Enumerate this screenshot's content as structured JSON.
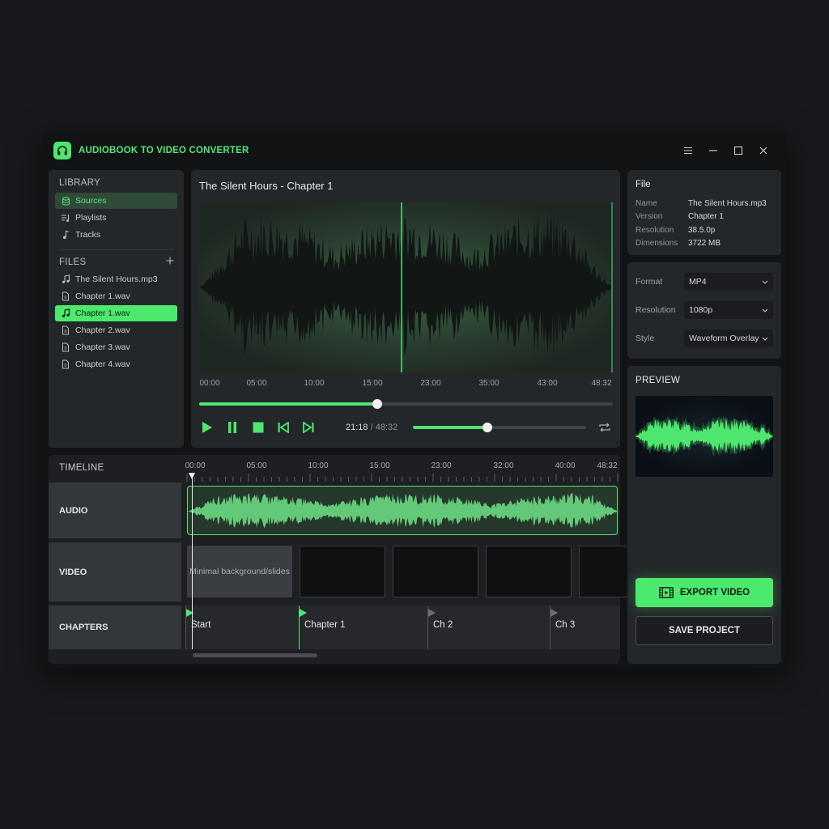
{
  "app": {
    "title": "AUDIOBOOK TO VIDEO CONVERTER"
  },
  "library": {
    "title": "LIBRARY",
    "items": [
      {
        "label": "Sources",
        "icon": "database-icon"
      },
      {
        "label": "Playlists",
        "icon": "playlist-icon"
      },
      {
        "label": "Tracks",
        "icon": "music-note-icon"
      }
    ],
    "files_title": "FILES",
    "files": [
      {
        "label": "The Silent Hours.mp3",
        "icon": "music-note-icon"
      },
      {
        "label": "Chapter 1.wav",
        "icon": "file-icon"
      },
      {
        "label": "Chapter 1.wav",
        "icon": "music-note-icon"
      },
      {
        "label": "Chapter 2.wav",
        "icon": "file-icon"
      },
      {
        "label": "Chapter 3.wav",
        "icon": "file-icon"
      },
      {
        "label": "Chapter 4.wav",
        "icon": "file-icon"
      }
    ]
  },
  "player": {
    "title": "The Silent Hours - Chapter 1",
    "ticks": [
      "00:00",
      "05:00",
      "10:00",
      "15:00",
      "23:00",
      "35:00",
      "43:00",
      "48:32"
    ],
    "progress": 0.43,
    "current_time": "21:18",
    "separator": "/",
    "total_time": "48:32",
    "volume": 0.43
  },
  "file_info": {
    "title": "File",
    "rows": [
      {
        "key": "Name",
        "value": "The Silent Hours.mp3"
      },
      {
        "key": "Version",
        "value": "Chapter 1"
      },
      {
        "key": "Resolution",
        "value": "38.5.0p"
      },
      {
        "key": "Dimensions",
        "value": "3722 MB"
      }
    ]
  },
  "settings": {
    "format_label": "Format",
    "format_value": "MP4",
    "resolution_label": "Resolution",
    "resolution_value": "1080p",
    "style_label": "Style",
    "style_value": "Waveform Overlay"
  },
  "preview": {
    "title": "PREVIEW",
    "export_label": "EXPORT VIDEO",
    "save_label": "SAVE PROJECT"
  },
  "timeline": {
    "title": "TIMELINE",
    "ticks": [
      "00:00",
      "05:00",
      "10:00",
      "15:00",
      "23:00",
      "32:00",
      "40:00",
      "48:32"
    ],
    "tracks": {
      "audio": "AUDIO",
      "video": "VIDEO",
      "chapters": "CHAPTERS"
    },
    "video_first_clip": "Minimal background/slides",
    "chapters": [
      {
        "label": "Start"
      },
      {
        "label": "Chapter 1"
      },
      {
        "label": "Ch 2"
      },
      {
        "label": "Ch 3"
      }
    ]
  },
  "colors": {
    "accent": "#4bea6c",
    "panel": "#24272a",
    "background": "#17191c"
  }
}
